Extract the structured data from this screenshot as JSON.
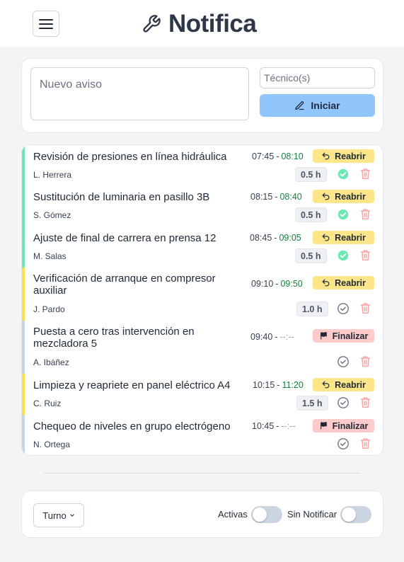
{
  "header": {
    "title": "Notifica",
    "logo_icon": "wrench-icon",
    "menu_icon": "hamburger-icon"
  },
  "new_notice": {
    "aviso_placeholder": "Nuevo aviso",
    "tecnico_placeholder": "Técnico(s)",
    "start_label": "Iniciar",
    "start_icon": "edit-icon",
    "start_color": "#93c5fd"
  },
  "colors": {
    "done_accent": "#6ee7b7",
    "progress_accent": "#fde047",
    "pending_accent": "#cbd5e1",
    "reopen_bg": "#fde68a",
    "finish_bg": "#fecaca",
    "end_time_green": "#15803d",
    "trash_red": "#fca5a5",
    "check_done": "#6ee7b7"
  },
  "tasks": [
    {
      "title": "Revisión de presiones en línea hidráulica",
      "tech": "L. Herrera",
      "start": "07:45",
      "sep": "-",
      "end": "08:10",
      "duration": "0.5 h",
      "action": "Reabrir",
      "action_icon": "reopen-icon",
      "status": "done"
    },
    {
      "title": "Sustitución de luminaria en pasillo 3B",
      "tech": "S. Gómez",
      "start": "08:15",
      "sep": "-",
      "end": "08:40",
      "duration": "0.5 h",
      "action": "Reabrir",
      "action_icon": "reopen-icon",
      "status": "done"
    },
    {
      "title": "Ajuste de final de carrera en prensa 12",
      "tech": "M. Salas",
      "start": "08:45",
      "sep": "-",
      "end": "09:05",
      "duration": "0.5 h",
      "action": "Reabrir",
      "action_icon": "reopen-icon",
      "status": "done"
    },
    {
      "title": "Verificación de arranque en compresor auxiliar",
      "tech": "J. Pardo",
      "start": "09:10",
      "sep": "-",
      "end": "09:50",
      "duration": "1.0 h",
      "action": "Reabrir",
      "action_icon": "reopen-icon",
      "status": "finished"
    },
    {
      "title": "Puesta a cero tras intervención en mezcladora 5",
      "tech": "A. Ibáñez",
      "start": "09:40",
      "sep": "-",
      "end": "--:--",
      "duration": "",
      "action": "Finalizar",
      "action_icon": "flag-icon",
      "status": "open"
    },
    {
      "title": "Limpieza y reapriete en panel eléctrico A4",
      "tech": "C. Ruiz",
      "start": "10:15",
      "sep": "-",
      "end": "11:20",
      "duration": "1.5 h",
      "action": "Reabrir",
      "action_icon": "reopen-icon",
      "status": "finished"
    },
    {
      "title": "Chequeo de niveles en grupo electrógeno",
      "tech": "N. Ortega",
      "start": "10:45",
      "sep": "-",
      "end": "--:--",
      "duration": "",
      "action": "Finalizar",
      "action_icon": "flag-icon",
      "status": "open"
    }
  ],
  "footer": {
    "turno_label": "Turno",
    "activas_label": "Activas",
    "activas_on": false,
    "sin_notificar_label": "Sin Notificar",
    "sin_notificar_on": false
  }
}
